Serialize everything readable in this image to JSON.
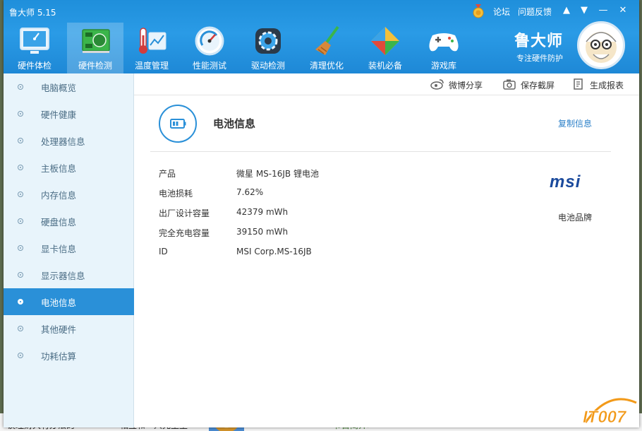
{
  "window": {
    "title": "鲁大师 5.15"
  },
  "titlebar": {
    "links": [
      "论坛",
      "问题反馈"
    ],
    "controls": [
      "skin",
      "menu",
      "minimize",
      "close"
    ]
  },
  "nav": {
    "items": [
      {
        "label": "硬件体检",
        "icon": "monitor-icon"
      },
      {
        "label": "硬件检测",
        "icon": "circuit-board-icon",
        "active": true
      },
      {
        "label": "温度管理",
        "icon": "thermometer-icon"
      },
      {
        "label": "性能测试",
        "icon": "speedometer-icon"
      },
      {
        "label": "驱动检测",
        "icon": "gear-icon"
      },
      {
        "label": "清理优化",
        "icon": "broom-icon"
      },
      {
        "label": "装机必备",
        "icon": "cube-icon"
      },
      {
        "label": "游戏库",
        "icon": "gamepad-icon"
      }
    ]
  },
  "brand": {
    "name": "鲁大师",
    "slogan": "专注硬件防护"
  },
  "sidebar": {
    "items": [
      {
        "label": "电脑概览"
      },
      {
        "label": "硬件健康"
      },
      {
        "label": "处理器信息"
      },
      {
        "label": "主板信息"
      },
      {
        "label": "内存信息"
      },
      {
        "label": "硬盘信息"
      },
      {
        "label": "显卡信息"
      },
      {
        "label": "显示器信息"
      },
      {
        "label": "电池信息",
        "active": true
      },
      {
        "label": "其他硬件"
      },
      {
        "label": "功耗估算"
      }
    ]
  },
  "toolbar": {
    "share": "微博分享",
    "screenshot": "保存截屏",
    "report": "生成报表"
  },
  "content": {
    "title": "电池信息",
    "copy": "复制信息",
    "rows": [
      {
        "label": "产品",
        "value": "微星 MS-16JB 锂电池"
      },
      {
        "label": "电池损耗",
        "value": "7.62%"
      },
      {
        "label": "出厂设计容量",
        "value": "42379 mWh"
      },
      {
        "label": "完全充电容量",
        "value": "39150 mWh"
      },
      {
        "label": "ID",
        "value": "MSI Corp.MS-16JB"
      }
    ],
    "brand_logo": "msi",
    "brand_caption": "电池品牌"
  },
  "background": {
    "texts": [
      "谈理财大有办法的",
      "相互和一人先生至",
      "节目简介>"
    ]
  },
  "watermark": "IT007",
  "colors": {
    "header": "#2a9be6",
    "accent": "#2a90d8",
    "link": "#2a7fc8",
    "msi": "#1b4a9c"
  }
}
